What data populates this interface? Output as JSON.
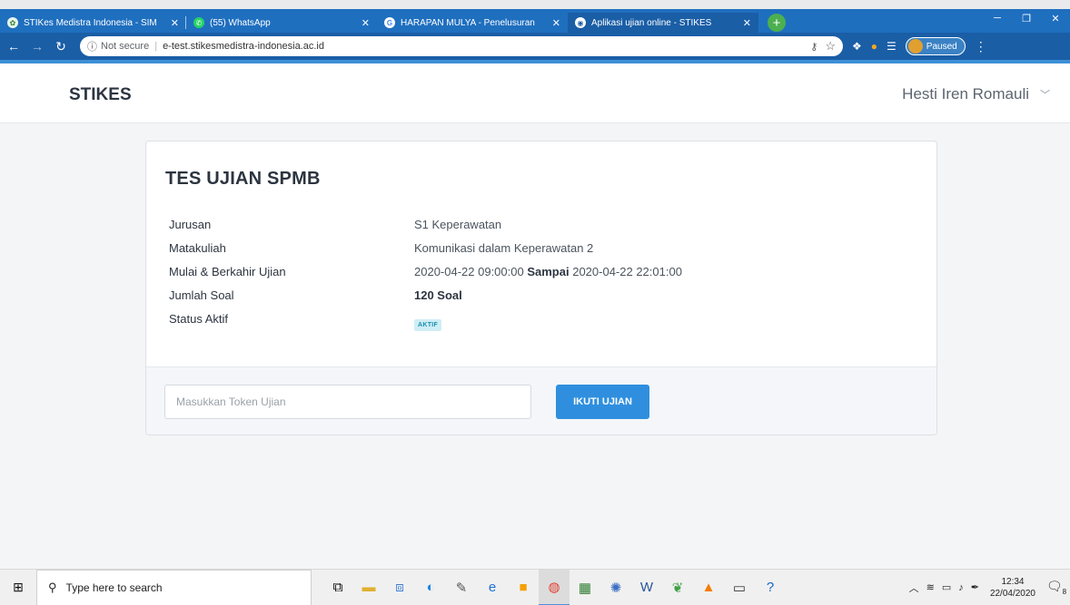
{
  "browser": {
    "tabs": [
      {
        "title": "STIKes Medistra Indonesia - SIM",
        "icon": "leaf-icon",
        "color": "#2e7d32"
      },
      {
        "title": "(55) WhatsApp",
        "icon": "whatsapp-icon",
        "color": "#25d366"
      },
      {
        "title": "HARAPAN MULYA - Penelusuran",
        "icon": "google-icon",
        "color": "#4285f4"
      },
      {
        "title": "Aplikasi ujian online - STIKES",
        "icon": "globe-icon",
        "color": "#ffffff"
      }
    ],
    "whatsapp_badge": "55",
    "address": {
      "security": "Not secure",
      "url": "e-test.stikesmedistra-indonesia.ac.id"
    },
    "profile_status": "Paused"
  },
  "app": {
    "brand": "STIKES",
    "user_name": "Hesti Iren Romauli"
  },
  "exam": {
    "title": "TES UJIAN SPMB",
    "fields": {
      "jurusan_label": "Jurusan",
      "jurusan_value": "S1 Keperawatan",
      "matakuliah_label": "Matakuliah",
      "matakuliah_value": "Komunikasi dalam Keperawatan 2",
      "waktu_label": "Mulai & Berkahir Ujian",
      "waktu_start": "2020-04-22 09:00:00",
      "waktu_sep": "Sampai",
      "waktu_end": "2020-04-22 22:01:00",
      "jumlah_label": "Jumlah Soal",
      "jumlah_value": "120 Soal",
      "status_label": "Status Aktif",
      "status_value": "AKTIF"
    },
    "token_placeholder": "Masukkan Token Ujian",
    "token_value": "",
    "submit_label": "IKUTI UJIAN"
  },
  "taskbar": {
    "search_placeholder": "Type here to search",
    "time": "12:34",
    "date": "22/04/2020",
    "notification_count": "8"
  }
}
